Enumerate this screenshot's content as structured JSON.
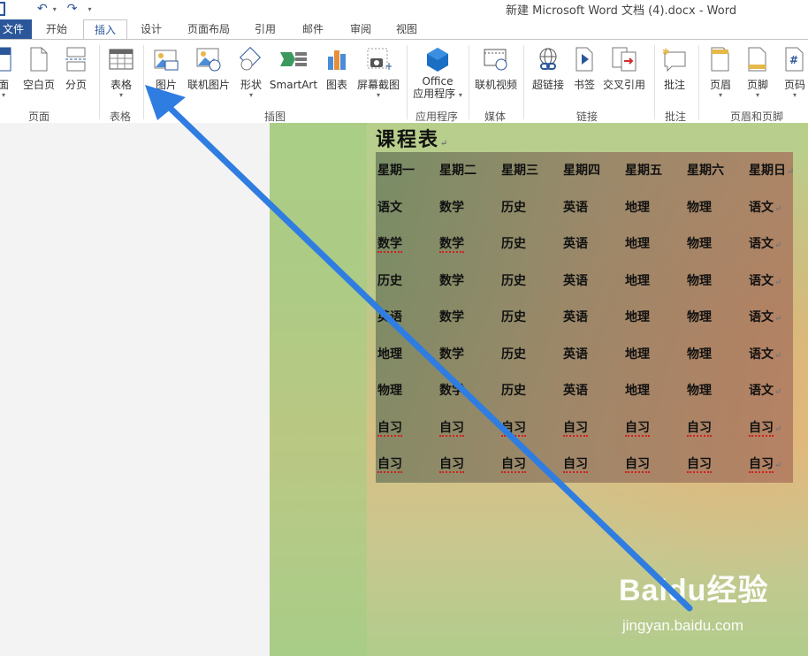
{
  "window": {
    "title": "新建 Microsoft Word 文档 (4).docx - Word"
  },
  "tabs": [
    {
      "label": "文件"
    },
    {
      "label": "开始"
    },
    {
      "label": "插入",
      "active": true
    },
    {
      "label": "设计"
    },
    {
      "label": "页面布局"
    },
    {
      "label": "引用"
    },
    {
      "label": "邮件"
    },
    {
      "label": "审阅"
    },
    {
      "label": "视图"
    }
  ],
  "ribbon": {
    "pages": {
      "cover": "面",
      "blank": "空白页",
      "break": "分页",
      "group": "页面"
    },
    "table": {
      "label": "表格",
      "group": "表格"
    },
    "illustrations": {
      "picture": "图片",
      "online_picture": "联机图片",
      "shapes": "形状",
      "smartart": "SmartArt",
      "chart": "图表",
      "screenshot": "屏幕截图",
      "group": "插图"
    },
    "apps": {
      "line1": "Office",
      "line2": "应用程序",
      "group": "应用程序"
    },
    "media": {
      "online_video": "联机视频",
      "group": "媒体"
    },
    "links": {
      "hyperlink": "超链接",
      "bookmark": "书签",
      "cross_ref": "交叉引用",
      "group": "链接"
    },
    "comments": {
      "comment": "批注",
      "group": "批注"
    },
    "header_footer": {
      "header": "页眉",
      "footer": "页脚",
      "page_number": "页码",
      "group": "页眉和页脚"
    }
  },
  "document": {
    "title": "课程表",
    "paragraph_mark": "↵",
    "headers": [
      "星期一",
      "星期二",
      "星期三",
      "星期四",
      "星期五",
      "星期六",
      "星期日"
    ],
    "rows": [
      [
        "语文",
        "数学",
        "历史",
        "英语",
        "地理",
        "物理",
        "语文"
      ],
      [
        "数学",
        "数学",
        "历史",
        "英语",
        "地理",
        "物理",
        "语文"
      ],
      [
        "历史",
        "数学",
        "历史",
        "英语",
        "地理",
        "物理",
        "语文"
      ],
      [
        "英语",
        "数学",
        "历史",
        "英语",
        "地理",
        "物理",
        "语文"
      ],
      [
        "地理",
        "数学",
        "历史",
        "英语",
        "地理",
        "物理",
        "语文"
      ],
      [
        "物理",
        "数学",
        "历史",
        "英语",
        "地理",
        "物理",
        "语文"
      ],
      [
        "自习",
        "自习",
        "自习",
        "自习",
        "自习",
        "自习",
        "自习"
      ],
      [
        "自习",
        "自习",
        "自习",
        "自习",
        "自习",
        "自习",
        "自习"
      ]
    ]
  },
  "watermark": {
    "brand": "Baidu经验",
    "url": "jingyan.baidu.com"
  },
  "colors": {
    "accent": "#2b579a",
    "arrow": "#2f7de1",
    "spellcheck": "#d02020"
  }
}
